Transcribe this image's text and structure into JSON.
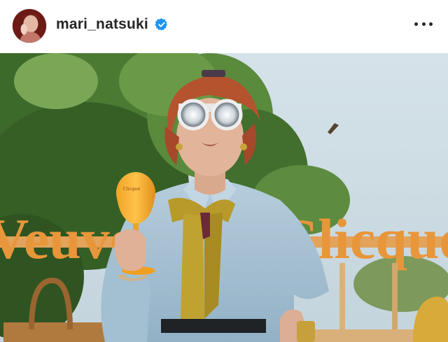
{
  "post": {
    "username": "mari_natsuki",
    "verified": true,
    "more_icon": "more-horizontal-icon",
    "avatar_icon": "profile-avatar"
  },
  "photo": {
    "sign_left": "Veuve",
    "sign_right": "Clicquot",
    "glass_text": "Clicquot",
    "colors": {
      "sky": "#cfdde5",
      "trees": "#3f6a2e",
      "beret": "#b5532e",
      "shirt": "#a9c3d6",
      "scarf": "#b79a2a",
      "sign": "#e79a3b"
    }
  }
}
